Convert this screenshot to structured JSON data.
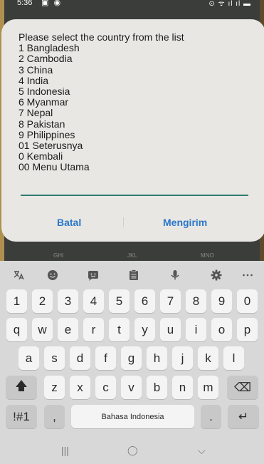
{
  "status_bar": {
    "time": "5:36",
    "left_icons": "▣ ◉",
    "right_icons": "⊙ ᯤ ıl ıl ▬"
  },
  "dialog": {
    "lines": [
      "Please select the country from the list",
      "1 Bangladesh",
      "2 Cambodia",
      "3 China",
      "4 India",
      "5 Indonesia",
      "6 Myanmar",
      "7 Nepal",
      "8 Pakistan",
      "9 Philippines",
      "01 Seterusnya",
      "0 Kembali",
      "00 Menu Utama"
    ],
    "input_value": "",
    "cancel_label": "Batal",
    "send_label": "Mengirim"
  },
  "keyboard_hints": [
    "GHI",
    "JKL",
    "MNO"
  ],
  "keyboard": {
    "toolbar_icons": [
      "translate-icon",
      "emoji-icon",
      "sticker-icon",
      "clipboard-icon",
      "microphone-icon",
      "gear-icon",
      "more-icon"
    ],
    "row_numbers": [
      "1",
      "2",
      "3",
      "4",
      "5",
      "6",
      "7",
      "8",
      "9",
      "0"
    ],
    "row_top": [
      "q",
      "w",
      "e",
      "r",
      "t",
      "y",
      "u",
      "i",
      "o",
      "p"
    ],
    "row_middle": [
      "a",
      "s",
      "d",
      "f",
      "g",
      "h",
      "j",
      "k",
      "l"
    ],
    "row_bottom": [
      "z",
      "x",
      "c",
      "v",
      "b",
      "n",
      "m"
    ],
    "symbols_label": "!#1",
    "comma_label": ",",
    "space_label": "Bahasa Indonesia",
    "period_label": ".",
    "shift_glyph": "🡅",
    "backspace_glyph": "⌫",
    "enter_glyph": "↵"
  },
  "navbar": {
    "recent": "|||",
    "home": "◯",
    "back": "⌵"
  }
}
